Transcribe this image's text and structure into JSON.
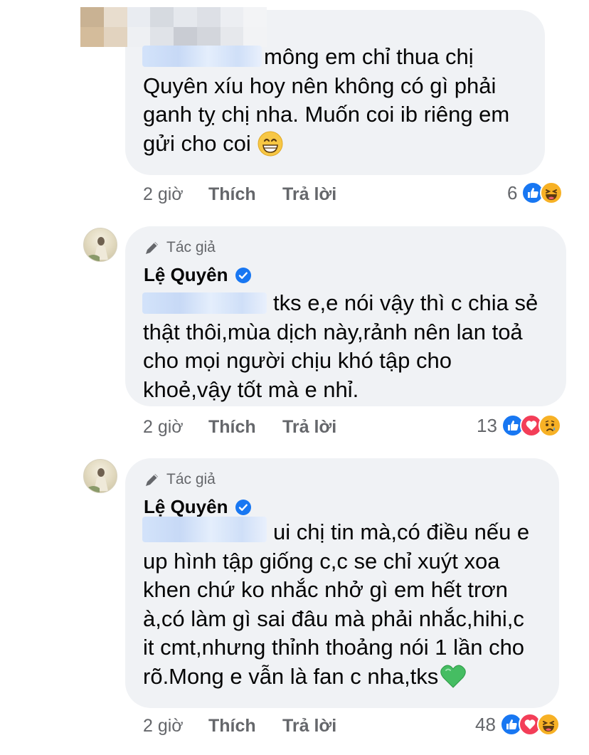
{
  "comments": [
    {
      "lines": [
        "mông em chỉ thua chị",
        "Quyên xíu hoy nên không có gì phải",
        "ganh tỵ chị nha. Muốn coi ib riêng em",
        "gửi cho coi"
      ],
      "emoji": "grin",
      "actions": {
        "time": "2 giờ",
        "like": "Thích",
        "reply": "Trả lời"
      },
      "reactions": {
        "count": "6",
        "icons": [
          "like-icon",
          "haha-icon"
        ]
      }
    },
    {
      "author_badge": "Tác giả",
      "author_name": "Lệ Quyên",
      "lines": [
        "tks e,e nói vậy thì c chia sẻ",
        "thật thôi,mùa dịch này,rảnh nên lan toả",
        "cho mọi người chịu khó tập cho",
        "khoẻ,vậy tốt mà e nhỉ."
      ],
      "actions": {
        "time": "2 giờ",
        "like": "Thích",
        "reply": "Trả lời"
      },
      "reactions": {
        "count": "13",
        "icons": [
          "like-icon",
          "love-icon",
          "sad-icon"
        ]
      }
    },
    {
      "author_badge": "Tác giả",
      "author_name": "Lệ Quyên",
      "lines": [
        "ui chị tin mà,có điều nếu e",
        "up hình tập giống c,c se chỉ xuýt xoa",
        "khen chứ ko nhắc nhở gì em hết trơn",
        "à,có làm gì sai đâu mà phải nhắc,hihi,c",
        "it cmt,nhưng thỉnh thoảng nói 1 lần cho",
        "rõ.Mong e vẫn là fan c nha,tks"
      ],
      "emoji": "green-heart",
      "actions": {
        "time": "2 giờ",
        "like": "Thích",
        "reply": "Trả lời"
      },
      "reactions": {
        "count": "48",
        "icons": [
          "like-icon",
          "love-icon",
          "haha-icon"
        ]
      }
    }
  ],
  "colors": {
    "bubble": "#f0f2f5",
    "text": "#050505",
    "meta": "#65676b",
    "like_blue": "#1877f2",
    "love_red": "#f33e58",
    "haha_yellow": "#f7b125",
    "verified_blue": "#1877f2",
    "green_heart": "#45bd62"
  }
}
